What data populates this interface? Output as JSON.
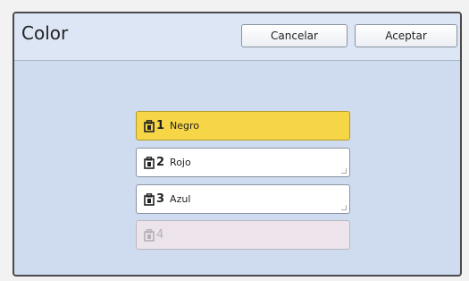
{
  "header": {
    "title": "Color",
    "cancel_label": "Cancelar",
    "ok_label": "Aceptar"
  },
  "drums": [
    {
      "number": "1",
      "label": "Negro",
      "selected": true
    },
    {
      "number": "2",
      "label": "Rojo",
      "selected": false
    },
    {
      "number": "3",
      "label": "Azul",
      "selected": false
    },
    {
      "number": "4",
      "label": "",
      "disabled": true
    }
  ],
  "colors": {
    "selected": "#f6d547",
    "panel": "#cfdcef",
    "disabled": "#ece4ea"
  }
}
